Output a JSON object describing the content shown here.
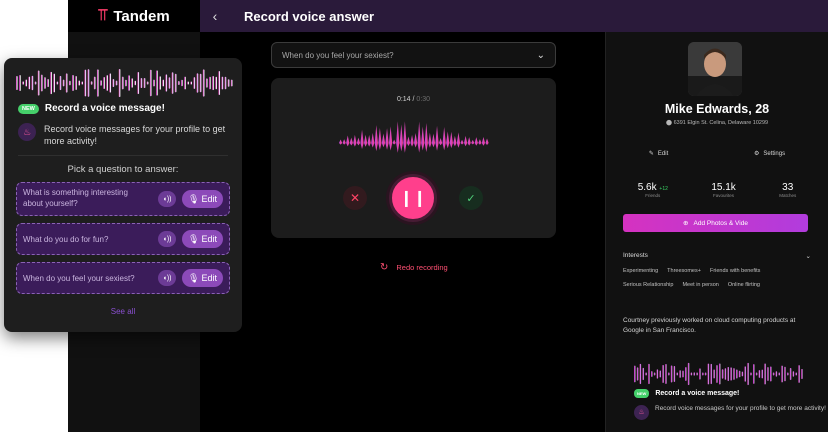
{
  "brand": {
    "name": "Tandem",
    "logo_icon": "tandem-logo-icon"
  },
  "topbar": {
    "title": "Record voice answer",
    "back_icon": "chevron-left-icon"
  },
  "main": {
    "question_select": {
      "value": "When do you feel your sexiest?"
    },
    "recorder": {
      "elapsed": "0:14",
      "separator": "/",
      "total": "0:30"
    },
    "redo_label": "Redo recording"
  },
  "profile": {
    "name": "Mike Edwards, 28",
    "location": "6391 Elgin St. Celina, Delaware 10299",
    "edit_label": "Edit",
    "settings_label": "Settings",
    "stats": [
      {
        "value": "5.6k",
        "delta": "+12",
        "label": "Friends"
      },
      {
        "value": "15.1k",
        "delta": "",
        "label": "Favourites"
      },
      {
        "value": "33",
        "delta": "",
        "label": "Matches"
      }
    ],
    "add_photos_label": "Add Photos & Vide",
    "interests_label": "Interests",
    "interests": [
      "Experimenting",
      "Threesomes+",
      "Friends with benefits",
      "Serious Relationship",
      "Meet in person",
      "Online flirting"
    ],
    "bio": "Courtney previously worked on cloud computing products at Google in San Francisco.",
    "voice_title": "Record a voice message!",
    "voice_badge": "NEW",
    "voice_desc": "Record voice messages for your profile to get more activity!"
  },
  "popup": {
    "badge": "NEW",
    "title": "Record a voice message!",
    "desc": "Record voice messages for your profile to get more activity!",
    "pick_label": "Pick a question to answer:",
    "questions": [
      {
        "text": "What is something interesting about yourself?",
        "edit_label": "Edit"
      },
      {
        "text": "What do you do for fun?",
        "edit_label": "Edit"
      },
      {
        "text": "When do you feel your sexiest?",
        "edit_label": "Edit"
      }
    ],
    "see_all_label": "See all"
  },
  "colors": {
    "accent": "#ff3f8c",
    "purple": "#b13cdd",
    "green": "#45cf6a",
    "topbar": "#2a1a3a"
  }
}
